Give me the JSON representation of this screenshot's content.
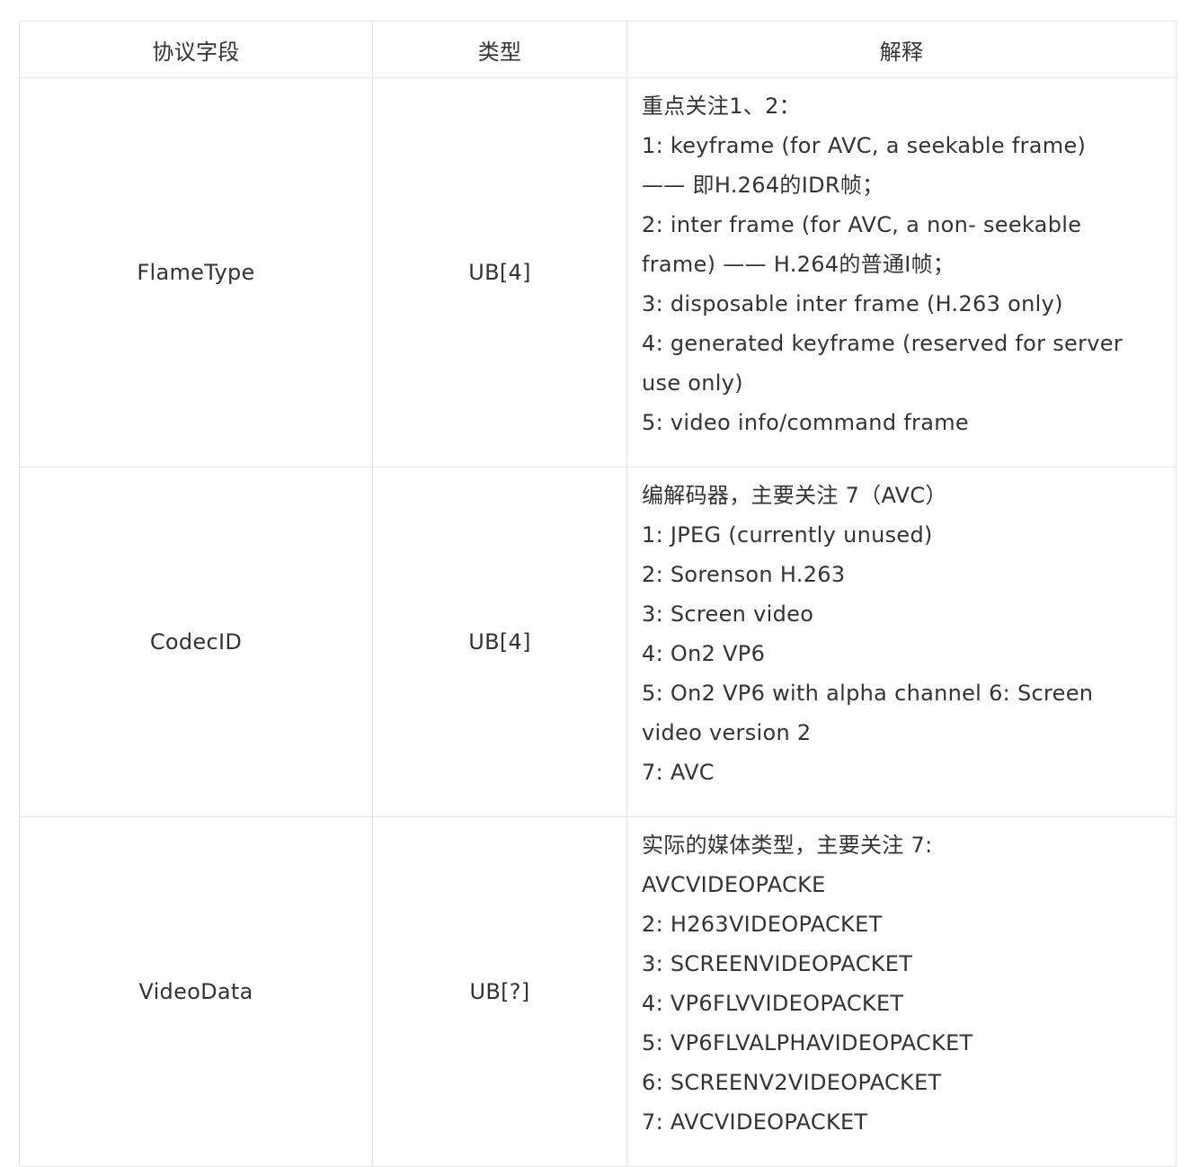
{
  "table": {
    "headers": [
      "协议字段",
      "类型",
      "解释"
    ],
    "rows": [
      {
        "field": "FlameType",
        "type": "UB[4]",
        "lines": [
          "重点关注1、2：",
          "1: keyframe (for AVC, a seekable frame)",
          "—— 即H.264的IDR帧；",
          "2: inter frame (for AVC, a non- seekable",
          "frame) —— H.264的普通I帧；",
          "3: disposable inter frame (H.263 only)",
          "4: generated keyframe (reserved for server",
          "use only)",
          "5: video info/command frame"
        ]
      },
      {
        "field": "CodecID",
        "type": "UB[4]",
        "lines": [
          "编解码器，主要关注 7（AVC）",
          "1: JPEG (currently unused)",
          "2: Sorenson H.263",
          "3: Screen video",
          "4: On2 VP6",
          "5: On2 VP6 with alpha channel 6: Screen",
          "video version 2",
          "7: AVC"
        ]
      },
      {
        "field": "VideoData",
        "type": "UB[?]",
        "lines": [
          "实际的媒体类型，主要关注 7:",
          "AVCVIDEOPACKE",
          "2: H263VIDEOPACKET",
          "3: SCREENVIDEOPACKET",
          "4: VP6FLVVIDEOPACKET",
          "5: VP6FLVALPHAVIDEOPACKET",
          "6: SCREENV2VIDEOPACKET",
          "7: AVCVIDEOPACKET"
        ]
      }
    ]
  }
}
